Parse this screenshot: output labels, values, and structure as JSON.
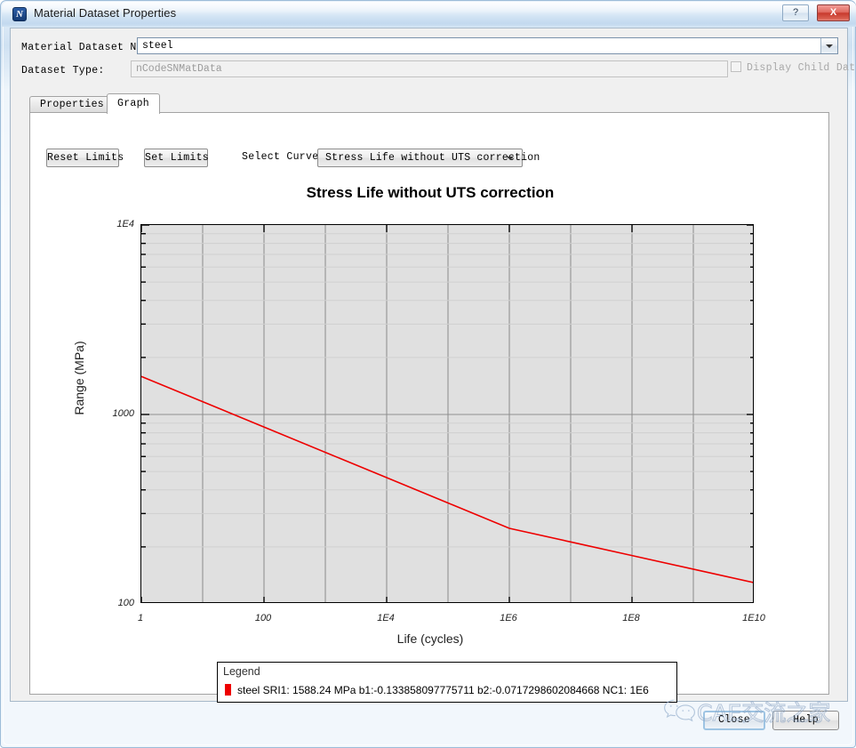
{
  "window": {
    "title": "Material Dataset Properties",
    "app_icon": "ncode-app-icon",
    "help_button_label": "?",
    "close_button_label": "X"
  },
  "form": {
    "dataset_name_label": "Material Dataset Name:",
    "dataset_name_value": "steel",
    "dataset_type_label": "Dataset Type:",
    "dataset_type_value": "nCodeSNMatData",
    "display_child_data_label": "Display Child Data",
    "display_child_data_checked": false
  },
  "tabs": [
    {
      "label": "Properties",
      "active": false
    },
    {
      "label": "Graph",
      "active": true
    }
  ],
  "toolbar": {
    "reset_limits_label": "Reset Limits",
    "set_limits_label": "Set Limits",
    "select_curve_label": "Select Curve",
    "select_curve_value": "Stress Life without UTS correction"
  },
  "legend": {
    "title": "Legend",
    "entry": "steel SRI1: 1588.24 MPa  b1:-0.133858097775711 b2:-0.0717298602084668 NC1: 1E6",
    "swatch_color": "#ee0000"
  },
  "footer": {
    "close_label": "Close",
    "help_label": "Help"
  },
  "watermark": {
    "text": "CAE交流之家",
    "logo": "wechat-logo"
  },
  "chart_data": {
    "type": "line",
    "title": "Stress Life without UTS correction",
    "xlabel": "Life (cycles)",
    "ylabel": "Range (MPa)",
    "xscale": "log",
    "yscale": "log",
    "xlim": [
      1,
      10000000000.0
    ],
    "ylim": [
      100,
      10000
    ],
    "xticks": [
      1,
      100,
      10000,
      1000000,
      100000000,
      10000000000
    ],
    "xtick_labels": [
      "1",
      "100",
      "1E4",
      "1E6",
      "1E8",
      "1E10"
    ],
    "yticks": [
      100,
      1000,
      10000
    ],
    "ytick_labels": [
      "100",
      "1000",
      "1E4"
    ],
    "grid": true,
    "grid_minor_x_decades": true,
    "grid_minor_y_log": true,
    "plot_bg": "#e0e0e0",
    "series": [
      {
        "name": "steel",
        "color": "#ee0000",
        "SRI1": 1588.24,
        "b1": -0.133858097775711,
        "b2": -0.0717298602084668,
        "NC1": 1000000,
        "points": [
          {
            "x": 1,
            "y": 1588.24
          },
          {
            "x": 10,
            "y": 1167.6
          },
          {
            "x": 100,
            "y": 858.4
          },
          {
            "x": 1000,
            "y": 631.1
          },
          {
            "x": 10000,
            "y": 463.9
          },
          {
            "x": 100000,
            "y": 341.1
          },
          {
            "x": 1000000,
            "y": 250.7
          },
          {
            "x": 10000000,
            "y": 212.4
          },
          {
            "x": 100000000,
            "y": 180.0
          },
          {
            "x": 1000000000,
            "y": 152.5
          },
          {
            "x": 10000000000,
            "y": 129.2
          }
        ]
      }
    ]
  }
}
